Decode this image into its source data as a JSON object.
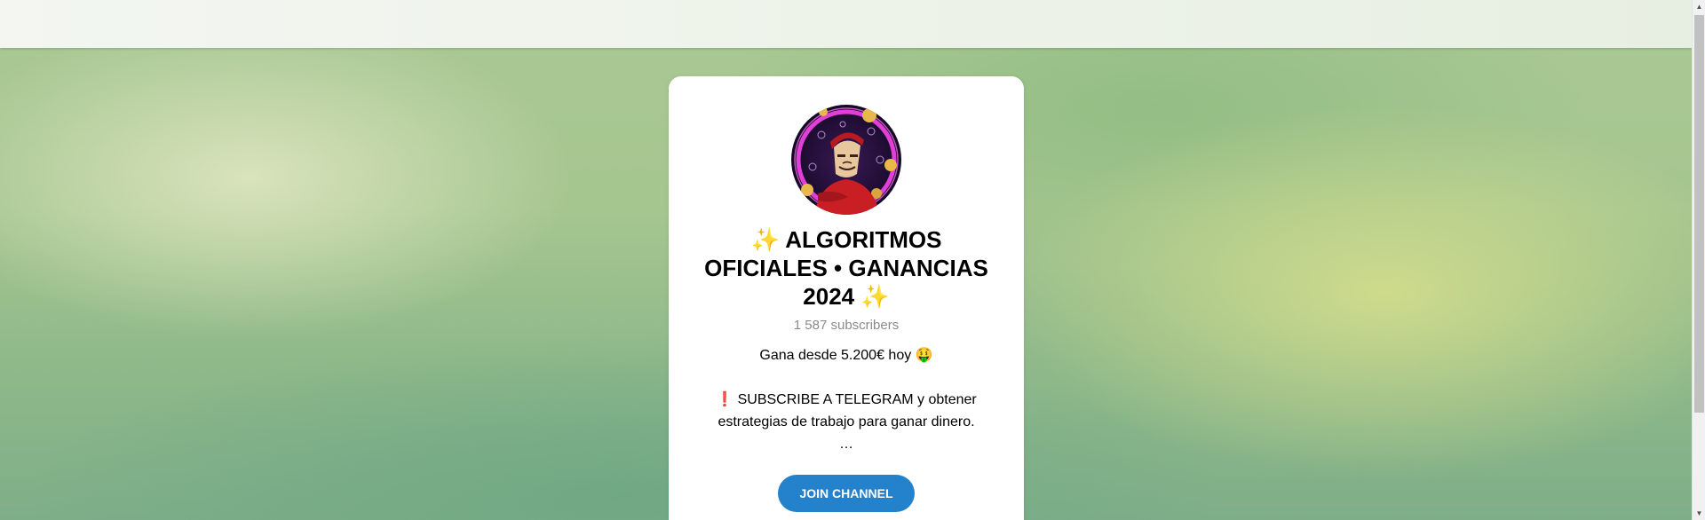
{
  "channel": {
    "title": "✨ ALGORITMOS OFICIALES • GANANCIAS 2024 ✨",
    "subscribers": "1 587 subscribers",
    "description_line1": "Gana desde 5.200€ hoy 🤑",
    "description_line2": "❗️ SUBSCRIBE A TELEGRAM y obtener estrategias de trabajo para ganar dinero.",
    "description_more": "…",
    "join_label": "JOIN CHANNEL"
  },
  "icons": {
    "scroll_up": "scroll-up-arrow-icon",
    "scroll_down": "scroll-down-arrow-icon"
  },
  "colors": {
    "accent": "#2481cc",
    "card": "#ffffff",
    "muted_text": "#8a8a8a"
  }
}
